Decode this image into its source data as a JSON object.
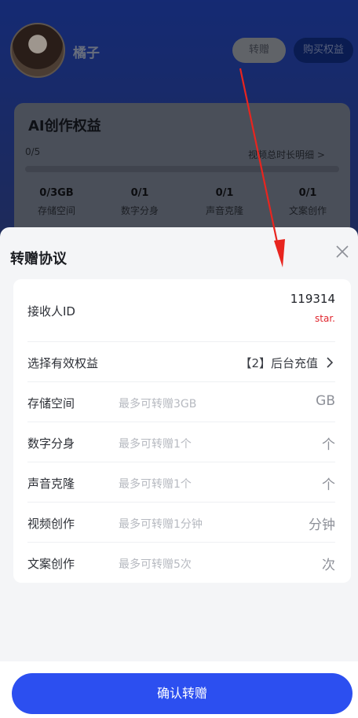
{
  "background": {
    "username": "橘子",
    "transfer_button": "转赠",
    "buy_button": "购买权益",
    "card": {
      "title": "AI创作权益",
      "progress_text": "0/5",
      "detail_link": "视频总时长明细 >",
      "stats": [
        {
          "value": "0/3GB",
          "label": "存储空间"
        },
        {
          "value": "0/1",
          "label": "数字分身"
        },
        {
          "value": "0/1",
          "label": "声音克隆"
        },
        {
          "value": "0/1",
          "label": "文案创作"
        }
      ]
    }
  },
  "sheet": {
    "title": "转赠协议",
    "recipient": {
      "label": "接收人ID",
      "id": "119314",
      "name": "star."
    },
    "choose": {
      "label": "选择有效权益",
      "value": "【2】后台充值"
    },
    "rows": [
      {
        "label": "存储空间",
        "placeholder": "最多可转赠3GB",
        "unit": "GB"
      },
      {
        "label": "数字分身",
        "placeholder": "最多可转赠1个",
        "unit": "个"
      },
      {
        "label": "声音克隆",
        "placeholder": "最多可转赠1个",
        "unit": "个"
      },
      {
        "label": "视频创作",
        "placeholder": "最多可转赠1分钟",
        "unit": "分钟"
      },
      {
        "label": "文案创作",
        "placeholder": "最多可转赠5次",
        "unit": "次"
      }
    ],
    "confirm_button": "确认转赠"
  },
  "colors": {
    "accent": "#2c4ff0",
    "recipient_name": "#e0242c",
    "annotation_arrow": "#e8251f"
  }
}
